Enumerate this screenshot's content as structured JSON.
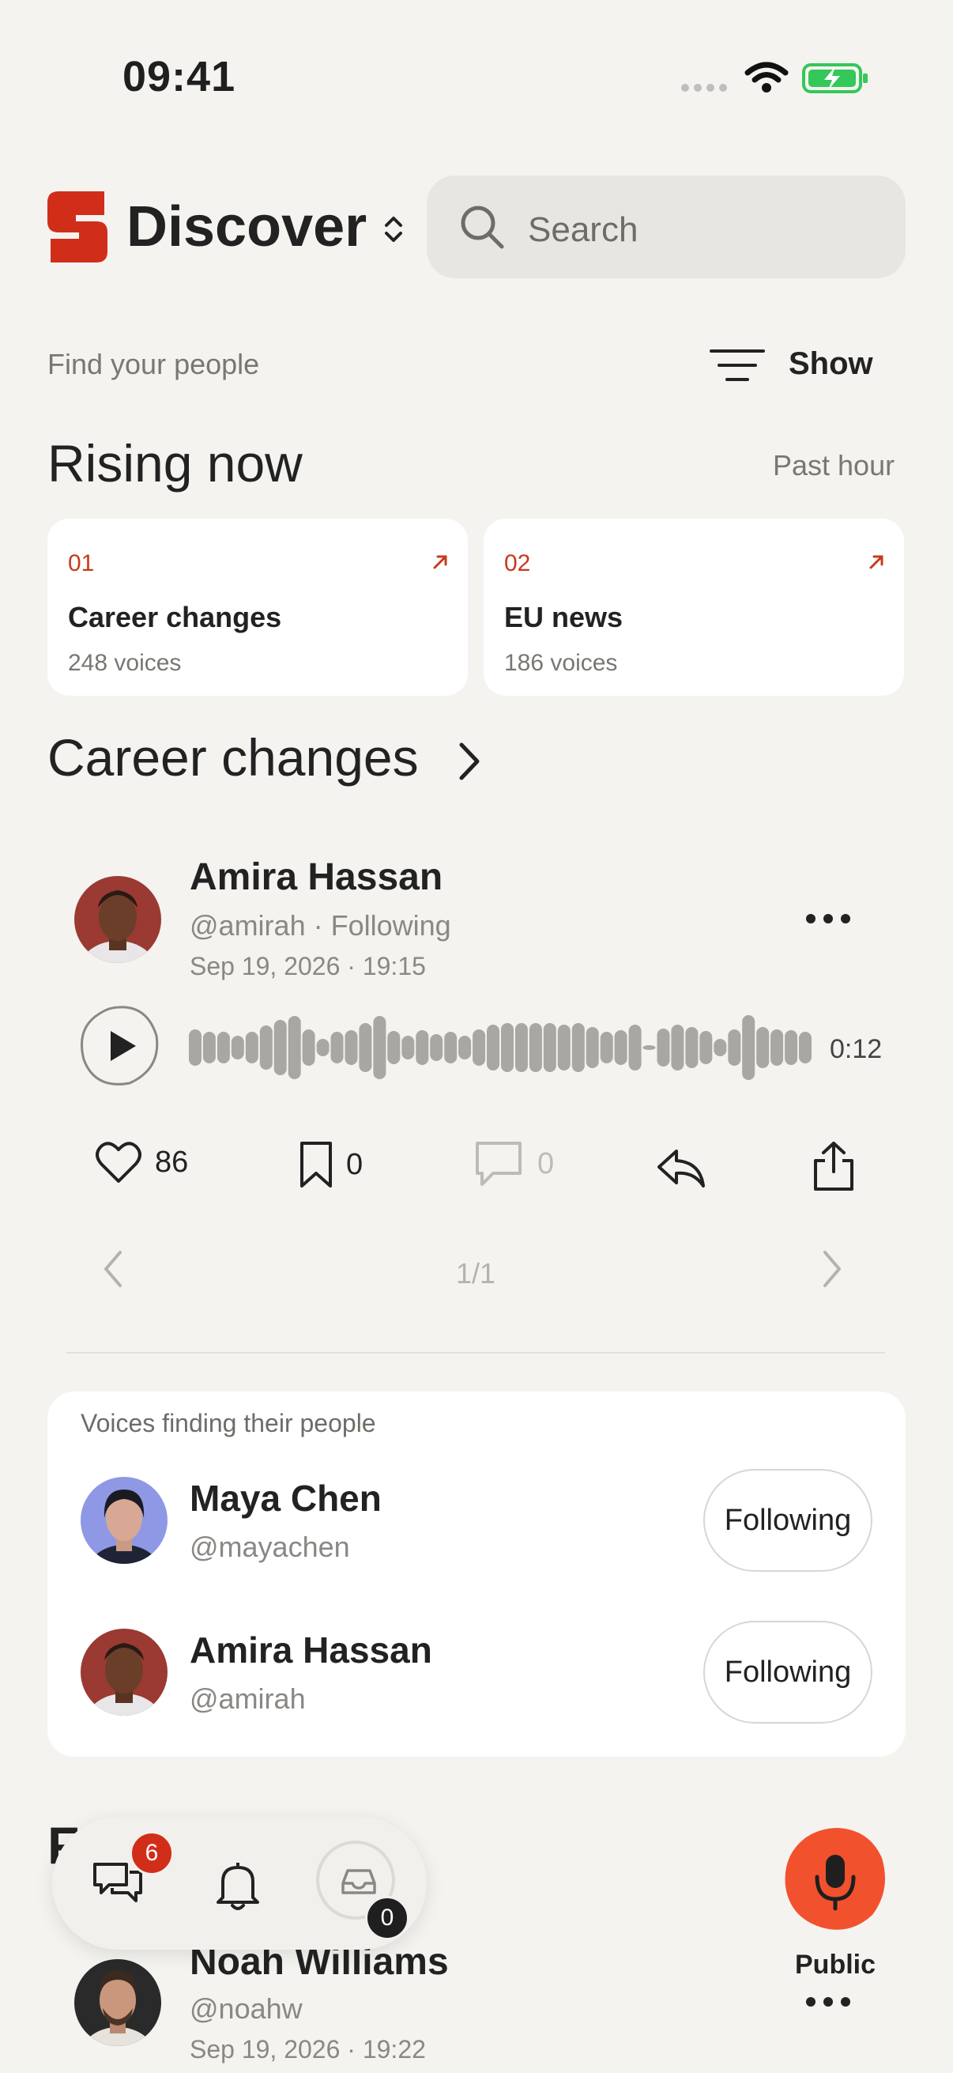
{
  "status_bar": {
    "time": "09:41"
  },
  "header": {
    "title": "Discover",
    "search_placeholder": "Search"
  },
  "filter": {
    "caption": "Find your people",
    "show_label": "Show"
  },
  "rising": {
    "title": "Rising now",
    "range": "Past hour",
    "cards": [
      {
        "num": "01",
        "title": "Career changes",
        "sub": "248 voices"
      },
      {
        "num": "02",
        "title": "EU news",
        "sub": "186 voices"
      }
    ]
  },
  "section": {
    "title": "Career changes"
  },
  "post": {
    "name": "Amira Hassan",
    "handle": "@amirah · Following",
    "date": "Sep 19, 2026 · 19:15",
    "duration": "0:12",
    "likes": "86",
    "bookmarks": "0",
    "comments": "0",
    "page": "1/1"
  },
  "suggestions": {
    "title": "Voices finding their people",
    "people": [
      {
        "name": "Maya Chen",
        "handle": "@mayachen",
        "button": "Following"
      },
      {
        "name": "Amira Hassan",
        "handle": "@amirah",
        "button": "Following"
      }
    ]
  },
  "next": {
    "heading": "F",
    "name": "Noah Williams",
    "handle": "@noahw",
    "date": "Sep 19, 2026 · 19:22"
  },
  "nav": {
    "chat_badge": "6",
    "inbox_count": "0",
    "mic_label": "Public"
  },
  "colors": {
    "accent": "#D12E1A",
    "mic": "#F2512E",
    "background": "#F4F3F0"
  }
}
